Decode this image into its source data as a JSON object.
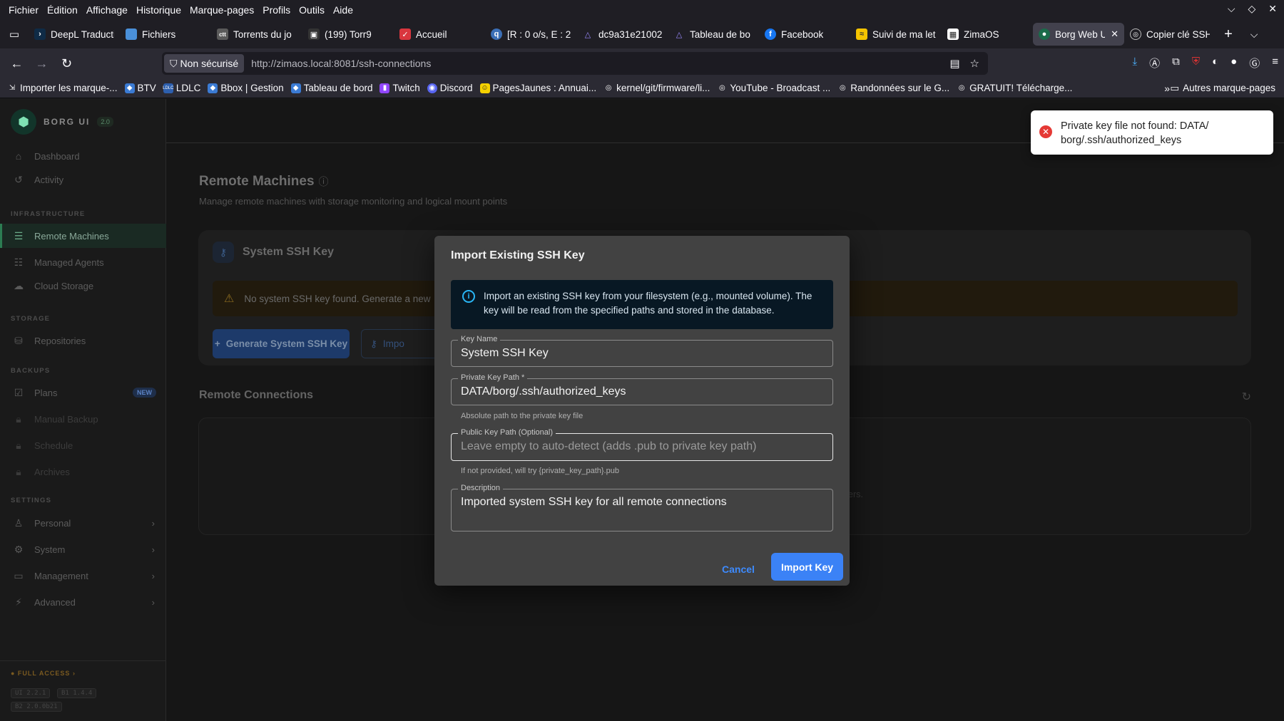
{
  "browser": {
    "menu": [
      "Fichier",
      "Édition",
      "Affichage",
      "Historique",
      "Marque-pages",
      "Profils",
      "Outils",
      "Aide"
    ],
    "tabs": [
      {
        "label": "DeepL Traducti",
        "icon": "deepl-icon",
        "color": "#0f2b46"
      },
      {
        "label": "Fichiers",
        "icon": "folder-icon",
        "color": "#4a90d9"
      },
      {
        "label": "Torrents du jo",
        "icon": "torrent-icon",
        "color": "#5a5a5a"
      },
      {
        "label": "(199) Torr9",
        "icon": "torr9-icon",
        "color": "#333"
      },
      {
        "label": "Accueil",
        "icon": "home-app-icon",
        "color": "#d9363e"
      },
      {
        "label": "[R : 0 o/s, E : 2",
        "icon": "qbittorrent-icon",
        "color": "#3b6fb6"
      },
      {
        "label": "dc9a31e21002",
        "icon": "triangle-icon",
        "color": "#7b61ff"
      },
      {
        "label": "Tableau de bo",
        "icon": "triangle-icon",
        "color": "#7b61ff"
      },
      {
        "label": "Facebook",
        "icon": "facebook-icon",
        "color": "#1877f2"
      },
      {
        "label": "Suivi de ma let",
        "icon": "laposte-icon",
        "color": "#f5c400"
      },
      {
        "label": "ZimaOS",
        "icon": "zimaos-icon",
        "color": "#ffffff"
      },
      {
        "label": "Borg Web U",
        "icon": "borg-icon",
        "color": "#1a6b4a",
        "active": true
      },
      {
        "label": "Copier clé SSH",
        "icon": "globe-icon",
        "color": "#555"
      }
    ],
    "security_label": "Non sécurisé",
    "url": "http://zimaos.local:8081/ssh-connections",
    "bookmarks": [
      {
        "label": "Importer les marque-...",
        "icon": "import-icon",
        "color": "#555"
      },
      {
        "label": "BTV",
        "icon": "btv-icon",
        "color": "#3b7bd4"
      },
      {
        "label": "LDLC",
        "icon": "ldlc-icon",
        "color": "#2d5fae"
      },
      {
        "label": "Bbox | Gestion",
        "icon": "bbox-icon",
        "color": "#3b7bd4"
      },
      {
        "label": "Tableau de bord",
        "icon": "tableau-icon",
        "color": "#3b7bd4"
      },
      {
        "label": "Twitch",
        "icon": "twitch-icon",
        "color": "#9146ff"
      },
      {
        "label": "Discord",
        "icon": "discord-icon",
        "color": "#5865f2"
      },
      {
        "label": "PagesJaunes : Annuai...",
        "icon": "pagesjaunes-icon",
        "color": "#f5d100"
      },
      {
        "label": "kernel/git/firmware/li...",
        "icon": "globe-icon",
        "color": "#555"
      },
      {
        "label": "YouTube - Broadcast ...",
        "icon": "globe-icon",
        "color": "#555"
      },
      {
        "label": "Randonnées sur le G...",
        "icon": "globe-icon",
        "color": "#555"
      },
      {
        "label": "GRATUIT! Télécharge...",
        "icon": "globe-icon",
        "color": "#555"
      }
    ],
    "other_bookmarks": "Autres marque-pages"
  },
  "sidebar": {
    "brand": "BORG UI",
    "version_badge": "2.0",
    "items_top": [
      {
        "label": "Dashboard",
        "icon": "home-icon"
      },
      {
        "label": "Activity",
        "icon": "history-icon"
      }
    ],
    "section_infrastructure": "INFRASTRUCTURE",
    "items_infra": [
      {
        "label": "Remote Machines",
        "icon": "server-icon"
      },
      {
        "label": "Managed Agents",
        "icon": "agents-icon"
      },
      {
        "label": "Cloud Storage",
        "icon": "cloud-icon"
      }
    ],
    "section_storage": "STORAGE",
    "items_storage": [
      {
        "label": "Repositories",
        "icon": "database-icon"
      }
    ],
    "section_backups": "BACKUPS",
    "items_backups": [
      {
        "label": "Plans",
        "icon": "list-check-icon",
        "badge": "NEW"
      },
      {
        "label": "Manual Backup",
        "icon": "lock-icon"
      },
      {
        "label": "Schedule",
        "icon": "lock-icon"
      },
      {
        "label": "Archives",
        "icon": "lock-icon"
      }
    ],
    "section_settings": "SETTINGS",
    "items_settings": [
      {
        "label": "Personal",
        "icon": "user-icon"
      },
      {
        "label": "System",
        "icon": "gear-icon"
      },
      {
        "label": "Management",
        "icon": "management-icon"
      },
      {
        "label": "Advanced",
        "icon": "bolt-icon"
      }
    ],
    "access": "● FULL ACCESS ›",
    "versions": [
      "UI 2.2.1",
      "B1 1.4.4",
      "B2 2.0.0b21"
    ]
  },
  "main": {
    "title": "Remote Machines",
    "subtitle": "Manage remote machines with storage monitoring and logical mount points",
    "ssh_card_title": "System SSH Key",
    "warning_text": "No system SSH key found. Generate a new",
    "generate_button": "Generate System SSH Key",
    "import_button_partial": "Impo",
    "remote_connections_title": "Remote Connections",
    "behind_modal_text": "ers."
  },
  "toast": {
    "message_line1": "Private key file not found: DATA/",
    "message_line2": "borg/.ssh/authorized_keys"
  },
  "modal": {
    "title": "Import Existing SSH Key",
    "info_text_line1": "Import an existing SSH key from your filesystem (e.g., mounted volume). The",
    "info_text_line2": "key will be read from the specified paths and stored in the database.",
    "key_name_label": "Key Name",
    "key_name_value": "System SSH Key",
    "private_key_label": "Private Key Path *",
    "private_key_value": "DATA/borg/.ssh/authorized_keys",
    "private_key_helper": "Absolute path to the private key file",
    "public_key_label": "Public Key Path (Optional)",
    "public_key_placeholder": "Leave empty to auto-detect (adds .pub to private key path)",
    "public_key_helper": "If not provided, will try {private_key_path}.pub",
    "description_label": "Description",
    "description_value": "Imported system SSH key for all remote connections",
    "cancel": "Cancel",
    "import": "Import Key"
  }
}
